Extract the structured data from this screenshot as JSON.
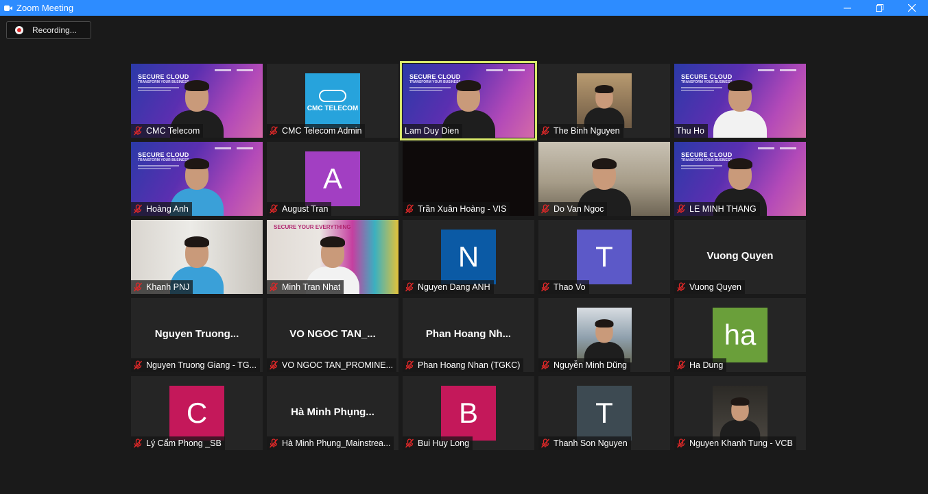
{
  "window": {
    "title": "Zoom Meeting",
    "minimize_icon": "minimize-icon",
    "maximize_icon": "restore-icon",
    "close_icon": "close-icon"
  },
  "recording": {
    "label": "Recording...",
    "icon": "record-icon"
  },
  "colors": {
    "titlebar": "#2d8cff",
    "active_speaker_border": "#d8e86a",
    "muted_mic": "#e02828"
  },
  "participants": [
    {
      "name": "CMC Telecom",
      "muted": true,
      "type": "video"
    },
    {
      "name": "CMC Telecom Admin",
      "muted": true,
      "type": "logo",
      "logo_text": "CMC TELECOM"
    },
    {
      "name": "Lam Duy Dien",
      "muted": false,
      "type": "video",
      "active": true
    },
    {
      "name": "The Binh Nguyen",
      "muted": true,
      "type": "photo"
    },
    {
      "name": "Thu Ho",
      "muted": false,
      "type": "video"
    },
    {
      "name": "Hoàng Anh",
      "muted": true,
      "type": "video"
    },
    {
      "name": "August Tran",
      "muted": true,
      "type": "avatar",
      "initials": "A",
      "color": "#a23fc2"
    },
    {
      "name": "Trần Xuân Hoàng - VIS",
      "muted": true,
      "type": "video"
    },
    {
      "name": "Do Van Ngoc",
      "muted": true,
      "type": "video"
    },
    {
      "name": "LE MINH THANG",
      "muted": true,
      "type": "video"
    },
    {
      "name": "Khanh PNJ",
      "muted": true,
      "type": "video"
    },
    {
      "name": "Minh Tran Nhat",
      "muted": true,
      "type": "video"
    },
    {
      "name": "Nguyen Dang ANH",
      "muted": true,
      "type": "avatar",
      "initials": "N",
      "color": "#0b5aa5"
    },
    {
      "name": "Thao Vo",
      "muted": true,
      "type": "avatar",
      "initials": "T",
      "color": "#5c59c8"
    },
    {
      "name": "Vuong Quyen",
      "muted": true,
      "type": "name",
      "display_name": "Vuong Quyen"
    },
    {
      "name": "Nguyen Truong Giang - TG...",
      "muted": true,
      "type": "name",
      "display_name": "Nguyen  Truong..."
    },
    {
      "name": "VO NGOC TAN_PROMINE...",
      "muted": true,
      "type": "name",
      "display_name": "VO NGOC TAN_..."
    },
    {
      "name": "Phan Hoang Nhan (TGKC)",
      "muted": true,
      "type": "name",
      "display_name": "Phan  Hoang  Nh..."
    },
    {
      "name": "Nguyễn Minh Dũng",
      "muted": true,
      "type": "photo"
    },
    {
      "name": "Ha Dung",
      "muted": true,
      "type": "avatar",
      "initials": "ha",
      "color": "#6a9f3a"
    },
    {
      "name": "Lý Cẩm Phong _SB",
      "muted": true,
      "type": "avatar",
      "initials": "C",
      "color": "#c4185a"
    },
    {
      "name": "Hà Minh Phụng_Mainstrea...",
      "muted": true,
      "type": "name",
      "display_name": "Hà  Minh  Phụng..."
    },
    {
      "name": "Bui Huy Long",
      "muted": true,
      "type": "avatar",
      "initials": "B",
      "color": "#c4185a"
    },
    {
      "name": "Thanh Son Nguyen",
      "muted": true,
      "type": "avatar",
      "initials": "T",
      "color": "#3d4a52"
    },
    {
      "name": "Nguyen Khanh Tung - VCB",
      "muted": true,
      "type": "photo"
    }
  ],
  "banner": {
    "line1": "SECURE CLOUD",
    "line2": "TRANSFORM YOUR BUSINESS"
  },
  "colorful_brand": "SECURE YOUR EVERYTHING"
}
